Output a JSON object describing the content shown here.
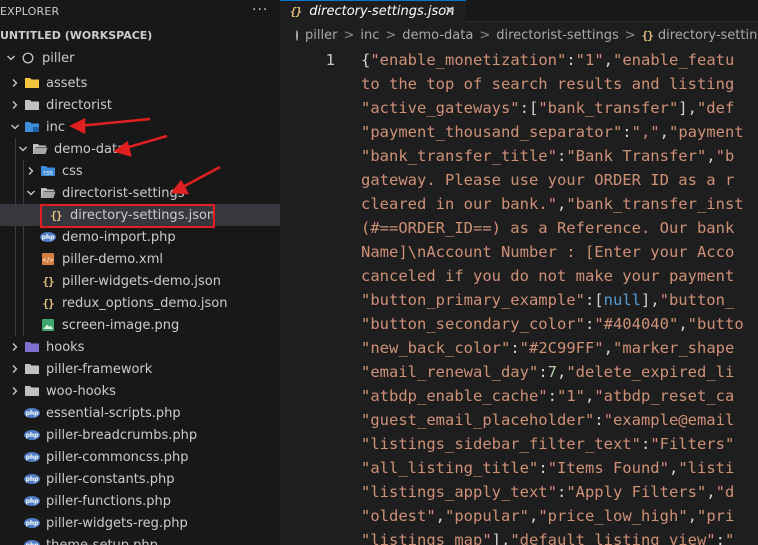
{
  "explorer": {
    "title": "EXPLORER",
    "more_actions": "···",
    "workspace": "UNTITLED (WORKSPACE)",
    "root_folder": "piller"
  },
  "tree": [
    {
      "label": "assets",
      "type": "folder",
      "icon": "folder-assets-icon",
      "depth": 1,
      "expanded": false
    },
    {
      "label": "directorist",
      "type": "folder",
      "icon": "folder-icon",
      "depth": 1,
      "expanded": false
    },
    {
      "label": "inc",
      "type": "folder",
      "icon": "folder-inc-icon",
      "depth": 1,
      "expanded": true
    },
    {
      "label": "demo-data",
      "type": "folder",
      "icon": "folder-open-icon",
      "depth": 2,
      "expanded": true
    },
    {
      "label": "css",
      "type": "folder",
      "icon": "folder-css-icon",
      "depth": 3,
      "expanded": false
    },
    {
      "label": "directorist-settings",
      "type": "folder",
      "icon": "folder-open-icon",
      "depth": 3,
      "expanded": true
    },
    {
      "label": "directory-settings.json",
      "type": "json",
      "icon": "json-file-icon",
      "depth": 4,
      "selected": true
    },
    {
      "label": "demo-import.php",
      "type": "php",
      "icon": "php-file-icon",
      "depth": 3
    },
    {
      "label": "piller-demo.xml",
      "type": "xml",
      "icon": "xml-file-icon",
      "depth": 3
    },
    {
      "label": "piller-widgets-demo.json",
      "type": "json",
      "icon": "json-file-icon",
      "depth": 3
    },
    {
      "label": "redux_options_demo.json",
      "type": "json",
      "icon": "json-file-icon",
      "depth": 3
    },
    {
      "label": "screen-image.png",
      "type": "image",
      "icon": "image-file-icon",
      "depth": 3
    },
    {
      "label": "hooks",
      "type": "folder",
      "icon": "folder-hooks-icon",
      "depth": 1,
      "expanded": false
    },
    {
      "label": "piller-framework",
      "type": "folder",
      "icon": "folder-icon",
      "depth": 1,
      "expanded": false
    },
    {
      "label": "woo-hooks",
      "type": "folder",
      "icon": "folder-icon",
      "depth": 1,
      "expanded": false
    },
    {
      "label": "essential-scripts.php",
      "type": "php",
      "icon": "php-file-icon",
      "depth": 1
    },
    {
      "label": "piller-breadcrumbs.php",
      "type": "php",
      "icon": "php-file-icon",
      "depth": 1
    },
    {
      "label": "piller-commoncss.php",
      "type": "php",
      "icon": "php-file-icon",
      "depth": 1
    },
    {
      "label": "piller-constants.php",
      "type": "php",
      "icon": "php-file-icon",
      "depth": 1
    },
    {
      "label": "piller-functions.php",
      "type": "php",
      "icon": "php-file-icon",
      "depth": 1
    },
    {
      "label": "piller-widgets-reg.php",
      "type": "php",
      "icon": "php-file-icon",
      "depth": 1
    },
    {
      "label": "theme-setup.php",
      "type": "php",
      "icon": "php-file-icon",
      "depth": 1
    }
  ],
  "tab": {
    "label": "directory-settings.json",
    "close": "×"
  },
  "breadcrumb": [
    "piller",
    "inc",
    "demo-data",
    "directorist-settings",
    "directory-settings.json"
  ],
  "breadcrumb_sep": ">",
  "editor": {
    "line_number": "1",
    "lines": [
      [
        [
          "p",
          "{"
        ],
        [
          "k",
          "\"enable_monetization\""
        ],
        [
          "p",
          ":"
        ],
        [
          "k",
          "\"1\""
        ],
        [
          "p",
          ","
        ],
        [
          "k",
          "\"enable_featu"
        ]
      ],
      [
        [
          "k",
          "to the top of search results and listing"
        ]
      ],
      [
        [
          "k",
          "\"active_gateways\""
        ],
        [
          "p",
          ":["
        ],
        [
          "k",
          "\"bank_transfer\""
        ],
        [
          "p",
          "],"
        ],
        [
          "k",
          "\"def"
        ]
      ],
      [
        [
          "k",
          "\"payment_thousand_separator\""
        ],
        [
          "p",
          ":"
        ],
        [
          "k",
          "\",\""
        ],
        [
          "p",
          ","
        ],
        [
          "k",
          "\"payment"
        ]
      ],
      [
        [
          "k",
          "\"bank_transfer_title\""
        ],
        [
          "p",
          ":"
        ],
        [
          "k",
          "\"Bank Transfer\""
        ],
        [
          "p",
          ","
        ],
        [
          "k",
          "\"b"
        ]
      ],
      [
        [
          "k",
          "gateway. Please use your ORDER ID as a r"
        ]
      ],
      [
        [
          "k",
          "cleared in our bank.\""
        ],
        [
          "p",
          ","
        ],
        [
          "k",
          "\"bank_transfer_inst"
        ]
      ],
      [
        [
          "k",
          "(#==ORDER_ID==) as a Reference. Our bank"
        ]
      ],
      [
        [
          "k",
          "Name]\\nAccount Number : [Enter your Acco"
        ]
      ],
      [
        [
          "k",
          "canceled if you do not make your payment"
        ]
      ],
      [
        [
          "k",
          "\"button_primary_example\""
        ],
        [
          "p",
          ":["
        ],
        [
          "b",
          "null"
        ],
        [
          "p",
          "],"
        ],
        [
          "k",
          "\"button_"
        ]
      ],
      [
        [
          "k",
          "\"button_secondary_color\""
        ],
        [
          "p",
          ":"
        ],
        [
          "k",
          "\"#404040\""
        ],
        [
          "p",
          ","
        ],
        [
          "k",
          "\"butto"
        ]
      ],
      [
        [
          "k",
          "\"new_back_color\""
        ],
        [
          "p",
          ":"
        ],
        [
          "k",
          "\"#2C99FF\""
        ],
        [
          "p",
          ","
        ],
        [
          "k",
          "\"marker_shape"
        ]
      ],
      [
        [
          "k",
          "\"email_renewal_day\""
        ],
        [
          "p",
          ":"
        ],
        [
          "n",
          "7"
        ],
        [
          "p",
          ","
        ],
        [
          "k",
          "\"delete_expired_li"
        ]
      ],
      [
        [
          "k",
          "\"atbdp_enable_cache\""
        ],
        [
          "p",
          ":"
        ],
        [
          "k",
          "\"1\""
        ],
        [
          "p",
          ","
        ],
        [
          "k",
          "\"atbdp_reset_ca"
        ]
      ],
      [
        [
          "k",
          "\"guest_email_placeholder\""
        ],
        [
          "p",
          ":"
        ],
        [
          "k",
          "\"example@email"
        ]
      ],
      [
        [
          "k",
          "\"listings_sidebar_filter_text\""
        ],
        [
          "p",
          ":"
        ],
        [
          "k",
          "\"Filters\""
        ]
      ],
      [
        [
          "k",
          "\"all_listing_title\""
        ],
        [
          "p",
          ":"
        ],
        [
          "k",
          "\"Items Found\""
        ],
        [
          "p",
          ","
        ],
        [
          "k",
          "\"listi"
        ]
      ],
      [
        [
          "k",
          "\"listings_apply_text\""
        ],
        [
          "p",
          ":"
        ],
        [
          "k",
          "\"Apply Filters\""
        ],
        [
          "p",
          ","
        ],
        [
          "k",
          "\"d"
        ]
      ],
      [
        [
          "k",
          "\"oldest\""
        ],
        [
          "p",
          ","
        ],
        [
          "k",
          "\"popular\""
        ],
        [
          "p",
          ","
        ],
        [
          "k",
          "\"price_low_high\""
        ],
        [
          "p",
          ","
        ],
        [
          "k",
          "\"pri"
        ]
      ],
      [
        [
          "k",
          "\"listings_map\""
        ],
        [
          "p",
          "],"
        ],
        [
          "k",
          "\"default_listing_view\""
        ],
        [
          "p",
          ":"
        ],
        [
          "k",
          "\""
        ]
      ]
    ]
  },
  "colors": {
    "accent": "#0078d4",
    "annotation_red": "#e02020",
    "string": "#ce9178",
    "punctuation": "#d4d4d4",
    "keyword": "#569cd6",
    "number": "#b5cea8"
  }
}
